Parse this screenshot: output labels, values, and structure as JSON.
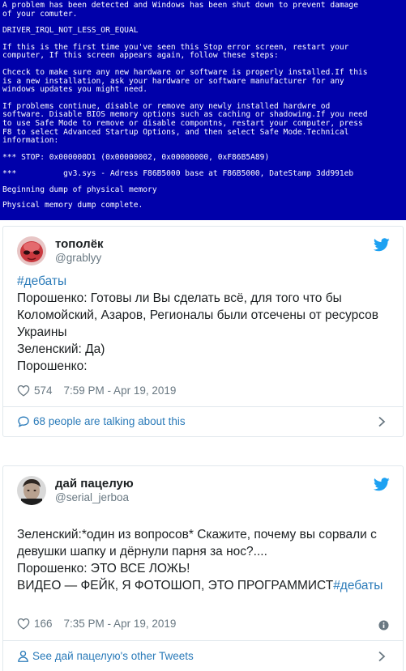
{
  "bsod": {
    "lines": [
      [
        "A problem has been detected and Windows has been shut down to prevent damage",
        "of your comuter."
      ],
      [
        "DRIVER_IRQL_NOT_LESS_OR_EQUAL"
      ],
      [
        "If this is the first time you've seen this Stop error screen, restart your",
        "computer, If this screen appears again, follow these steps:"
      ],
      [
        "Chceck to make sure any new hardware or software is properly installed.If this",
        "is a new installation, ask your hardware or software manufacturer for any",
        "windows updates you might need."
      ],
      [
        "If problems continue, disable or remove any newly installed hardwre od",
        "software. Disable BIOS memory options such as caching or shadowing.If you need",
        "to use Safe Mode to remove or disable compontns, restart your computer, press",
        "F8 to select Advanced Startup Options, and then select Safe Mode.Technical",
        "information:"
      ],
      [
        "*** STOP: 0x000000D1 (0x00000002, 0x00000000, 0xF86B5A89)"
      ],
      [
        "***          gv3.sys - Adress F86B5000 base at F86B5000, DateStamp 3dd991eb"
      ],
      [
        "Beginning dump of physical memory"
      ],
      [
        "Physical memory dump complete."
      ]
    ]
  },
  "tweet1": {
    "name": "тополёк",
    "handle": "@grablyy",
    "hashtag": "#дебаты",
    "line1": "Порошенко: Готовы ли Вы сделать всё, для того что бы Коломойский, Азаров, Регионалы были отсечены от ресурсов Украины",
    "line2": "Зеленский: Да)",
    "line3": "Порошенко:",
    "likes": "574",
    "time": "7:59 PM - Apr 19, 2019",
    "footer": "68 people are talking about this"
  },
  "tweet2": {
    "name": "дай пацелую",
    "handle": "@serial_jerboa",
    "line1": "Зеленский:*один из вопросов* Скажите, почему вы сорвали с девушки шапку и дёрнули парня за нос?....",
    "line2": "Порошенко: ЭТО ВСЕ ЛОЖЬ!",
    "line3_prefix": "ВИДЕО — ФЕЙК, Я ФОТОШОП, ЭТО ПРОГРАММИСТ",
    "hashtag": "#дебаты",
    "likes": "166",
    "time": "7:35 PM - Apr 19, 2019",
    "footer": "See дай пацелую's other Tweets"
  },
  "colors": {
    "bsod_bg": "#0000aa",
    "link": "#2b7bb9",
    "twitter_blue": "#1da1f2",
    "muted": "#697882"
  },
  "icons": [
    "twitter-bird-icon",
    "heart-icon",
    "comment-icon",
    "person-icon",
    "chevron-right-icon",
    "info-icon"
  ]
}
